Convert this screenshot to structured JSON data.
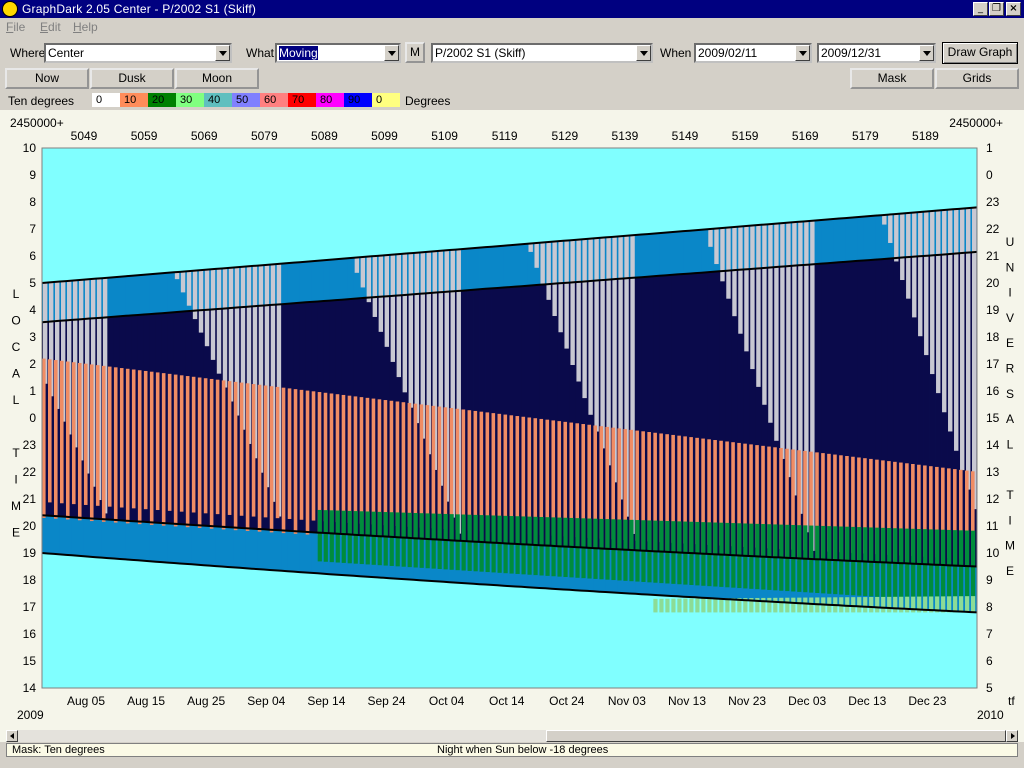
{
  "window": {
    "title": "GraphDark 2.05  Center  -  P/2002 S1 (Skiff)"
  },
  "menu": {
    "file": "ile",
    "edit": "dit",
    "help": "elp"
  },
  "toolbar": {
    "where_label": "Where",
    "where_value": "Center",
    "what_label": "What",
    "what_value": "Moving",
    "m_button": "M",
    "object_value": "P/2002 S1 (Skiff)",
    "when_label": "When",
    "when_start": "2009/02/11",
    "when_end": "2009/12/31",
    "draw_graph": "Draw Graph"
  },
  "toolbar2": {
    "now": "Now",
    "dusk": "Dusk",
    "moon": "Moon",
    "mask": "Mask",
    "grids": "Grids"
  },
  "legend": {
    "label": "Ten degrees",
    "units": "Degrees",
    "items": [
      {
        "text": "0",
        "color": "#ffffff"
      },
      {
        "text": "10",
        "color": "#ff8c5a"
      },
      {
        "text": "20",
        "color": "#008000"
      },
      {
        "text": "30",
        "color": "#80ff80"
      },
      {
        "text": "40",
        "color": "#5fbfbf"
      },
      {
        "text": "50",
        "color": "#8080ff"
      },
      {
        "text": "60",
        "color": "#ff8080"
      },
      {
        "text": "70",
        "color": "#ff0000"
      },
      {
        "text": "80",
        "color": "#ff00ff"
      },
      {
        "text": "90",
        "color": "#0000ff"
      },
      {
        "text": "0",
        "color": "#ffff80"
      }
    ]
  },
  "chart_data": {
    "type": "heatmap",
    "top_axis_offset_left": "2450000+",
    "top_axis_offset_right": "2450000+",
    "top_ticks": [
      "5049",
      "5059",
      "5069",
      "5079",
      "5089",
      "5099",
      "5109",
      "5119",
      "5129",
      "5139",
      "5149",
      "5159",
      "5169",
      "5179",
      "5189"
    ],
    "bottom_ticks": [
      "Aug 05",
      "Aug 15",
      "Aug 25",
      "Sep 04",
      "Sep 14",
      "Sep 24",
      "Oct 04",
      "Oct 14",
      "Oct 24",
      "Nov 03",
      "Nov 13",
      "Nov 23",
      "Dec 03",
      "Dec 13",
      "Dec 23"
    ],
    "year_start": "2009",
    "year_end": "2010",
    "corner_right": "tf",
    "left_ticks": [
      "10",
      "9",
      "8",
      "7",
      "6",
      "5",
      "4",
      "3",
      "2",
      "1",
      "0",
      "23",
      "22",
      "21",
      "20",
      "19",
      "18",
      "17",
      "16",
      "15",
      "14"
    ],
    "right_ticks": [
      "1",
      "0",
      "23",
      "22",
      "21",
      "20",
      "19",
      "18",
      "17",
      "16",
      "15",
      "14",
      "13",
      "12",
      "11",
      "10",
      "9",
      "8",
      "7",
      "6",
      "5"
    ],
    "left_axis_label": [
      "L",
      "O",
      "C",
      "A",
      "L",
      "",
      "T",
      "I",
      "M",
      "E"
    ],
    "right_axis_label": [
      "U",
      "N",
      "I",
      "V",
      "E",
      "R",
      "S",
      "A",
      "L",
      "",
      "T",
      "I",
      "M",
      "E"
    ],
    "colors": {
      "daylight": "#80ffff",
      "twilight": "#0a87c8",
      "night": "#0a0a4b",
      "moonlight": "#c8c8d2",
      "ten_deg": "#f08c64",
      "twenty_deg": "#008c3c",
      "thirty_deg": "#8cdc96"
    }
  },
  "status": {
    "mask_label": "Mask:  Ten degrees",
    "night_text": "Night when Sun below -18 degrees"
  }
}
